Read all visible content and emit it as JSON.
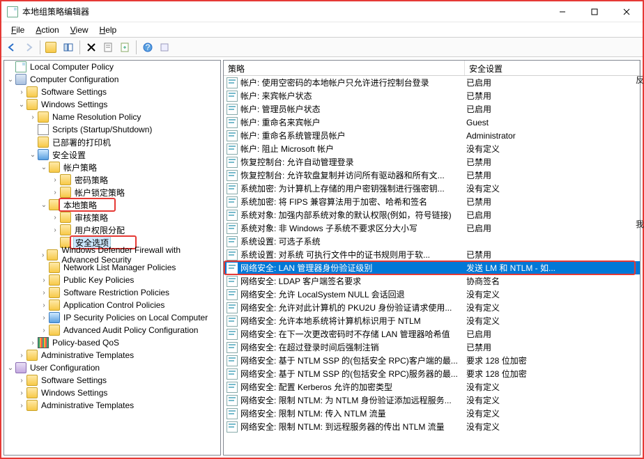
{
  "window": {
    "title": "本地组策略编辑器"
  },
  "menu": {
    "file": "File",
    "action": "Action",
    "view": "View",
    "help": "Help"
  },
  "columns": {
    "policy": "策略",
    "setting": "安全设置"
  },
  "tree": [
    {
      "d": 0,
      "exp": "none",
      "icon": "doc",
      "label": "Local Computer Policy"
    },
    {
      "d": 0,
      "exp": "open",
      "icon": "computer",
      "label": "Computer Configuration"
    },
    {
      "d": 1,
      "exp": "closed",
      "icon": "folder",
      "label": "Software Settings"
    },
    {
      "d": 1,
      "exp": "open",
      "icon": "folder",
      "label": "Windows Settings"
    },
    {
      "d": 2,
      "exp": "closed",
      "icon": "folder",
      "label": "Name Resolution Policy"
    },
    {
      "d": 2,
      "exp": "none",
      "icon": "script",
      "label": "Scripts (Startup/Shutdown)"
    },
    {
      "d": 2,
      "exp": "none",
      "icon": "folder",
      "label": "已部署的打印机"
    },
    {
      "d": 2,
      "exp": "open",
      "icon": "shield",
      "label": "安全设置"
    },
    {
      "d": 3,
      "exp": "open",
      "icon": "folder",
      "label": "帐户策略"
    },
    {
      "d": 4,
      "exp": "closed",
      "icon": "folder",
      "label": "密码策略"
    },
    {
      "d": 4,
      "exp": "closed",
      "icon": "folder",
      "label": "帐户锁定策略"
    },
    {
      "d": 3,
      "exp": "open",
      "icon": "folder",
      "label": "本地策略",
      "box": "node"
    },
    {
      "d": 4,
      "exp": "closed",
      "icon": "folder",
      "label": "审核策略"
    },
    {
      "d": 4,
      "exp": "closed",
      "icon": "folder",
      "label": "用户权限分配"
    },
    {
      "d": 4,
      "exp": "none",
      "icon": "folder",
      "label": "安全选项",
      "box": "label",
      "selected": true
    },
    {
      "d": 3,
      "exp": "closed",
      "icon": "folder",
      "label": "Windows Defender Firewall with Advanced Security"
    },
    {
      "d": 3,
      "exp": "none",
      "icon": "folder",
      "label": "Network List Manager Policies"
    },
    {
      "d": 3,
      "exp": "closed",
      "icon": "folder",
      "label": "Public Key Policies"
    },
    {
      "d": 3,
      "exp": "closed",
      "icon": "folder",
      "label": "Software Restriction Policies"
    },
    {
      "d": 3,
      "exp": "closed",
      "icon": "folder",
      "label": "Application Control Policies"
    },
    {
      "d": 3,
      "exp": "closed",
      "icon": "shield",
      "label": "IP Security Policies on Local Computer"
    },
    {
      "d": 3,
      "exp": "closed",
      "icon": "folder",
      "label": "Advanced Audit Policy Configuration"
    },
    {
      "d": 2,
      "exp": "closed",
      "icon": "bars",
      "label": "Policy-based QoS"
    },
    {
      "d": 1,
      "exp": "closed",
      "icon": "folder",
      "label": "Administrative Templates"
    },
    {
      "d": 0,
      "exp": "open",
      "icon": "user",
      "label": "User Configuration"
    },
    {
      "d": 1,
      "exp": "closed",
      "icon": "folder",
      "label": "Software Settings"
    },
    {
      "d": 1,
      "exp": "closed",
      "icon": "folder",
      "label": "Windows Settings"
    },
    {
      "d": 1,
      "exp": "closed",
      "icon": "folder",
      "label": "Administrative Templates"
    }
  ],
  "policies": [
    {
      "name": "帐户: 使用空密码的本地帐户只允许进行控制台登录",
      "setting": "已启用"
    },
    {
      "name": "帐户: 来宾帐户状态",
      "setting": "已禁用"
    },
    {
      "name": "帐户: 管理员帐户状态",
      "setting": "已启用"
    },
    {
      "name": "帐户: 重命名来宾帐户",
      "setting": "Guest"
    },
    {
      "name": "帐户: 重命名系统管理员帐户",
      "setting": "Administrator"
    },
    {
      "name": "帐户: 阻止 Microsoft 帐户",
      "setting": "没有定义"
    },
    {
      "name": "恢复控制台: 允许自动管理登录",
      "setting": "已禁用"
    },
    {
      "name": "恢复控制台: 允许软盘复制并访问所有驱动器和所有文...",
      "setting": "已禁用"
    },
    {
      "name": "系统加密: 为计算机上存储的用户密钥强制进行强密钥...",
      "setting": "没有定义"
    },
    {
      "name": "系统加密: 将 FIPS 兼容算法用于加密、哈希和签名",
      "setting": "已禁用"
    },
    {
      "name": "系统对象: 加强内部系统对象的默认权限(例如，符号链接)",
      "setting": "已启用"
    },
    {
      "name": "系统对象: 非 Windows 子系统不要求区分大小写",
      "setting": "已启用"
    },
    {
      "name": "系统设置: 可选子系统",
      "setting": ""
    },
    {
      "name": "系统设置: 对系统 可执行文件中的证书规则用于软...",
      "setting": "已禁用"
    },
    {
      "name": "网络安全: LAN 管理器身份验证级别",
      "setting": "发送 LM 和 NTLM - 如...",
      "selected": true,
      "highlight": true
    },
    {
      "name": "网络安全: LDAP 客户端签名要求",
      "setting": "协商签名"
    },
    {
      "name": "网络安全: 允许 LocalSystem NULL 会话回退",
      "setting": "没有定义"
    },
    {
      "name": "网络安全: 允许对此计算机的 PKU2U 身份验证请求使用...",
      "setting": "没有定义"
    },
    {
      "name": "网络安全: 允许本地系统将计算机标识用于 NTLM",
      "setting": "没有定义"
    },
    {
      "name": "网络安全: 在下一次更改密码时不存储 LAN 管理器哈希值",
      "setting": "已启用"
    },
    {
      "name": "网络安全: 在超过登录时间后强制注销",
      "setting": "已禁用"
    },
    {
      "name": "网络安全: 基于 NTLM SSP 的(包括安全 RPC)客户端的最...",
      "setting": "要求 128 位加密"
    },
    {
      "name": "网络安全: 基于 NTLM SSP 的(包括安全 RPC)服务器的最...",
      "setting": "要求 128 位加密"
    },
    {
      "name": "网络安全: 配置 Kerberos 允许的加密类型",
      "setting": "没有定义"
    },
    {
      "name": "网络安全: 限制 NTLM: 为 NTLM 身份验证添加远程服务...",
      "setting": "没有定义"
    },
    {
      "name": "网络安全: 限制 NTLM: 传入 NTLM 流量",
      "setting": "没有定义"
    },
    {
      "name": "网络安全: 限制 NTLM: 到远程服务器的传出 NTLM 流量",
      "setting": "没有定义"
    }
  ],
  "side_hints": [
    "反",
    "我"
  ]
}
